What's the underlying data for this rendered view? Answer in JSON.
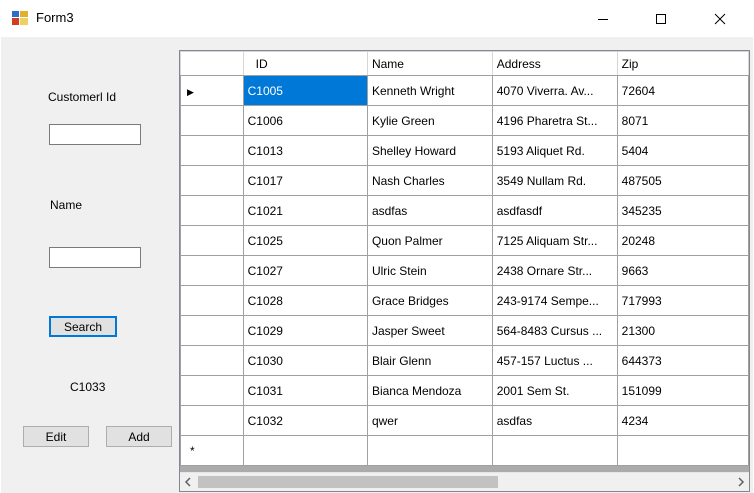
{
  "window": {
    "title": "Form3",
    "icon": "form-app-icon"
  },
  "form": {
    "customer_id_label": "Customerl Id",
    "customer_id_value": "",
    "name_label": "Name",
    "name_value": "",
    "search_button": "Search",
    "result_label": "C1033",
    "edit_button": "Edit",
    "add_button": "Add"
  },
  "grid": {
    "columns": [
      "ID",
      "Name",
      "Address",
      "Zip"
    ],
    "rows": [
      [
        "C1005",
        "Kenneth Wright",
        "4070 Viverra.  Av...",
        "72604"
      ],
      [
        "C1006",
        "Kylie Green",
        "4196 Pharetra  St...",
        "8071"
      ],
      [
        "C1013",
        "Shelley Howard",
        "5193 Aliquet Rd.",
        "5404"
      ],
      [
        "C1017",
        "Nash Charles",
        "3549 Nullam  Rd.",
        "487505"
      ],
      [
        "C1021",
        "asdfas",
        "asdfasdf",
        "345235"
      ],
      [
        "C1025",
        "Quon Palmer",
        "7125 Aliquam  Str...",
        "20248"
      ],
      [
        "C1027",
        "Ulric Stein",
        "2438 Ornare  Str...",
        "9663"
      ],
      [
        "C1028",
        "Grace Bridges",
        "243-9174 Sempe...",
        "717993"
      ],
      [
        "C1029",
        "Jasper Sweet",
        "564-8483 Cursus ...",
        "21300"
      ],
      [
        "C1030",
        "Blair Glenn",
        "457-157 Luctus  ...",
        "644373"
      ],
      [
        "C1031",
        "Bianca Mendoza",
        "2001 Sem St.",
        "151099"
      ],
      [
        "C1032",
        "qwer",
        "asdfas",
        "4234"
      ]
    ],
    "current_row_marker": "▶",
    "new_row_marker": "*",
    "selection_color": "#0078d7"
  }
}
